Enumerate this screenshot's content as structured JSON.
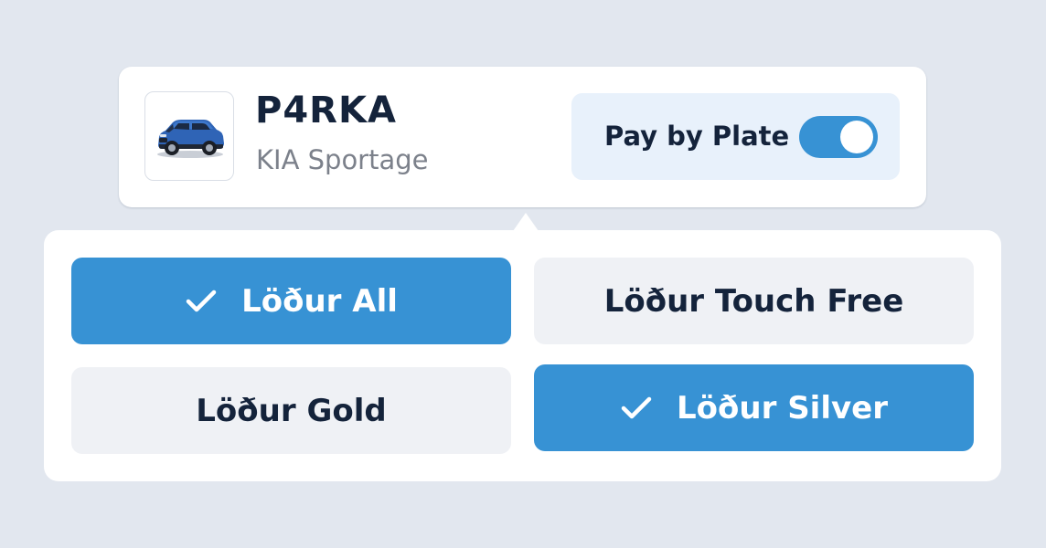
{
  "vehicle": {
    "plate": "P4RKA",
    "model": "KIA Sportage",
    "image_icon": "car-image"
  },
  "pay_by_plate": {
    "label": "Pay by Plate",
    "enabled": true
  },
  "options": [
    {
      "label": "Löður All",
      "selected": true
    },
    {
      "label": "Löður Touch Free",
      "selected": false
    },
    {
      "label": "Löður Gold",
      "selected": false
    },
    {
      "label": "Löður Silver",
      "selected": true
    }
  ],
  "colors": {
    "accent": "#3792d4",
    "background": "#e2e7ef",
    "text_dark": "#14233b",
    "text_muted": "#7c818b",
    "pay_box_bg": "#e8f1fb",
    "option_unselected_bg": "#eff1f5"
  }
}
